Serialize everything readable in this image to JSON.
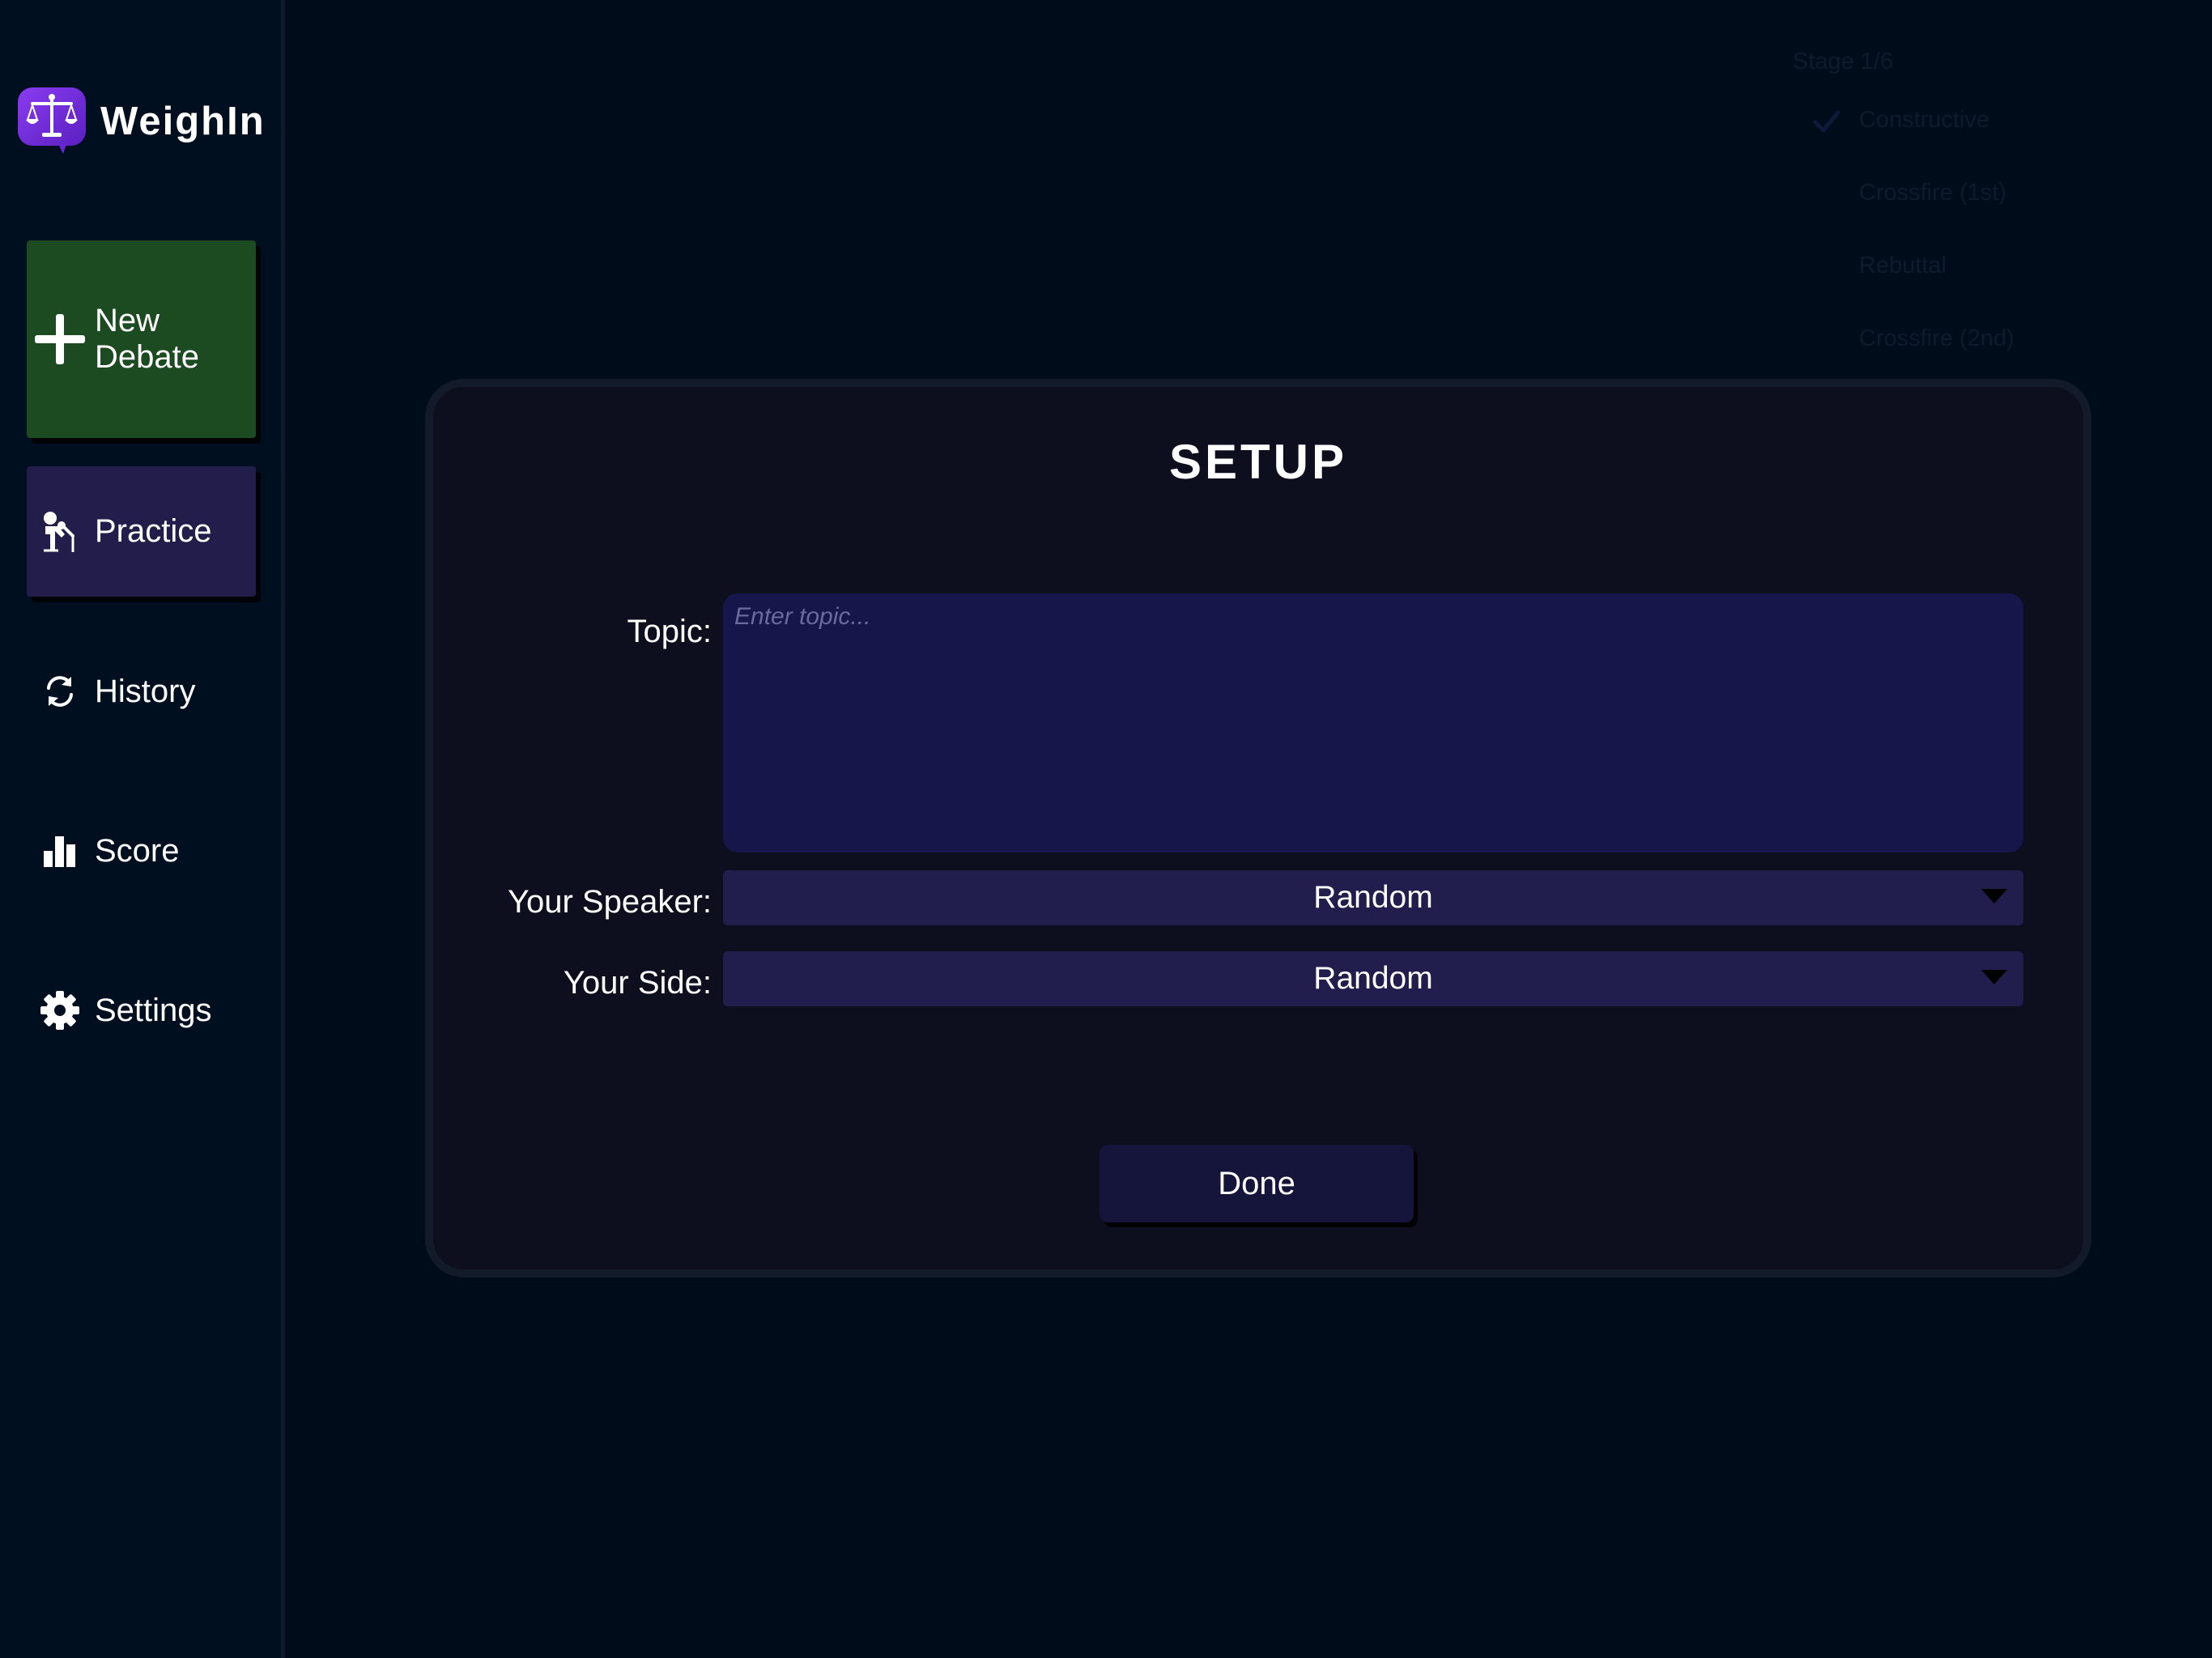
{
  "app": {
    "name": "WeighIn"
  },
  "sidebar": {
    "items": [
      {
        "label": "New\nDebate",
        "icon": "plus-icon"
      },
      {
        "label": "Practice",
        "icon": "podium-speaker-icon"
      },
      {
        "label": "History",
        "icon": "history-cycle-icon"
      },
      {
        "label": "Score",
        "icon": "bar-chart-icon"
      },
      {
        "label": "Settings",
        "icon": "gear-icon"
      }
    ]
  },
  "stages": {
    "title": "Stage 1/6",
    "items": [
      "Constructive",
      "Crossfire (1st)",
      "Rebuttal",
      "Crossfire (2nd)"
    ],
    "completed_icon": "check-icon"
  },
  "setup": {
    "title": "SETUP",
    "topic_label": "Topic:",
    "topic_placeholder": "Enter topic...",
    "topic_value": "",
    "speaker_label": "Your Speaker:",
    "speaker_value": "Random",
    "side_label": "Your Side:",
    "side_value": "Random",
    "done_label": "Done"
  },
  "colors": {
    "background": "#010c1b",
    "sidebar": "#000f20",
    "new_debate": "#1c4a21",
    "practice": "#231d4c",
    "modal": "#0d0e1e",
    "input": "#16164a",
    "select": "#211d4c",
    "logo_purple": "#7a2fe0"
  }
}
